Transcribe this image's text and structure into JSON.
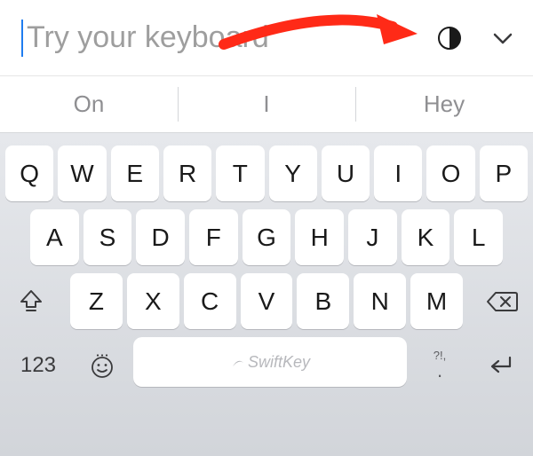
{
  "input": {
    "placeholder": "Try your keyboard",
    "value": ""
  },
  "suggestions": [
    "On",
    "I",
    "Hey"
  ],
  "keys": {
    "row1": [
      "Q",
      "W",
      "E",
      "R",
      "T",
      "Y",
      "U",
      "I",
      "O",
      "P"
    ],
    "row2": [
      "A",
      "S",
      "D",
      "F",
      "G",
      "H",
      "J",
      "K",
      "L"
    ],
    "row3": [
      "Z",
      "X",
      "C",
      "V",
      "B",
      "N",
      "M"
    ]
  },
  "numeric_label": "123",
  "punct_top": "?!,",
  "punct_bottom": ".",
  "space_brand": "SwiftKey",
  "icons": {
    "theme": "half-circle-icon",
    "chevron": "chevron-down-icon",
    "shift": "shift-icon",
    "backspace": "backspace-icon",
    "emoji": "emoji-icon",
    "return": "return-icon"
  },
  "annotation": {
    "type": "arrow",
    "color": "#ff2a17",
    "target": "theme-toggle"
  }
}
